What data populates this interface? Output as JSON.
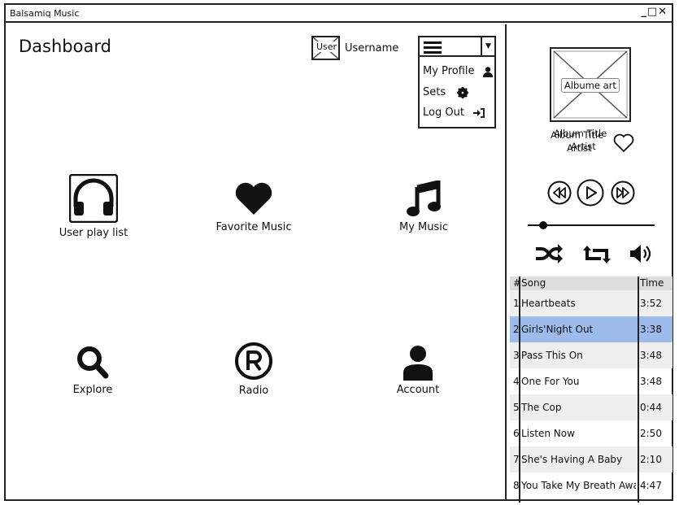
{
  "window": {
    "title": "Balsamiq Music",
    "controls": "_□✕"
  },
  "header": {
    "title": "Dashboard",
    "user_thumb_label": "User",
    "username": "Username"
  },
  "menu": {
    "items": [
      {
        "label": "My Profile",
        "icon": "user-icon"
      },
      {
        "label": "Sets",
        "icon": "gear-icon"
      },
      {
        "label": "Log Out",
        "icon": "sign-in-icon"
      }
    ]
  },
  "tiles": [
    {
      "label": "User play list",
      "icon": "headphones-icon"
    },
    {
      "label": "Favorite Music",
      "icon": "heart-icon"
    },
    {
      "label": "My Music",
      "icon": "music-note-icon"
    },
    {
      "label": "Explore",
      "icon": "search-icon"
    },
    {
      "label": "Radio",
      "icon": "registered-icon"
    },
    {
      "label": "Account",
      "icon": "user-icon"
    }
  ],
  "player": {
    "album_art_label": "Albume art",
    "album_title_a": "Album Title",
    "album_title_b": "Album Title",
    "artist_a": "Artist",
    "artist_b": "Artist",
    "progress": 0.09
  },
  "playlist": {
    "headers": {
      "num": "#",
      "song": "Song",
      "time": "Time"
    },
    "selected_index": 1,
    "rows": [
      {
        "num": "1",
        "song": "Heartbeats",
        "time": "3:52"
      },
      {
        "num": "2",
        "song": "Girls'Night Out",
        "time": "3:38"
      },
      {
        "num": "3",
        "song": "Pass This On",
        "time": "3:48"
      },
      {
        "num": "4",
        "song": "One For You",
        "time": "3:48"
      },
      {
        "num": "5",
        "song": "The Cop",
        "time": "0:44"
      },
      {
        "num": "6",
        "song": "Listen Now",
        "time": "2:50"
      },
      {
        "num": "7",
        "song": "She's Having A Baby",
        "time": "2:10"
      },
      {
        "num": "8",
        "song": "You Take My Breath Away",
        "time": "4:47"
      }
    ]
  },
  "colors": {
    "selected_row": "#9dbcec",
    "header_row": "#dddddd",
    "alt_row": "#eeeeee"
  }
}
